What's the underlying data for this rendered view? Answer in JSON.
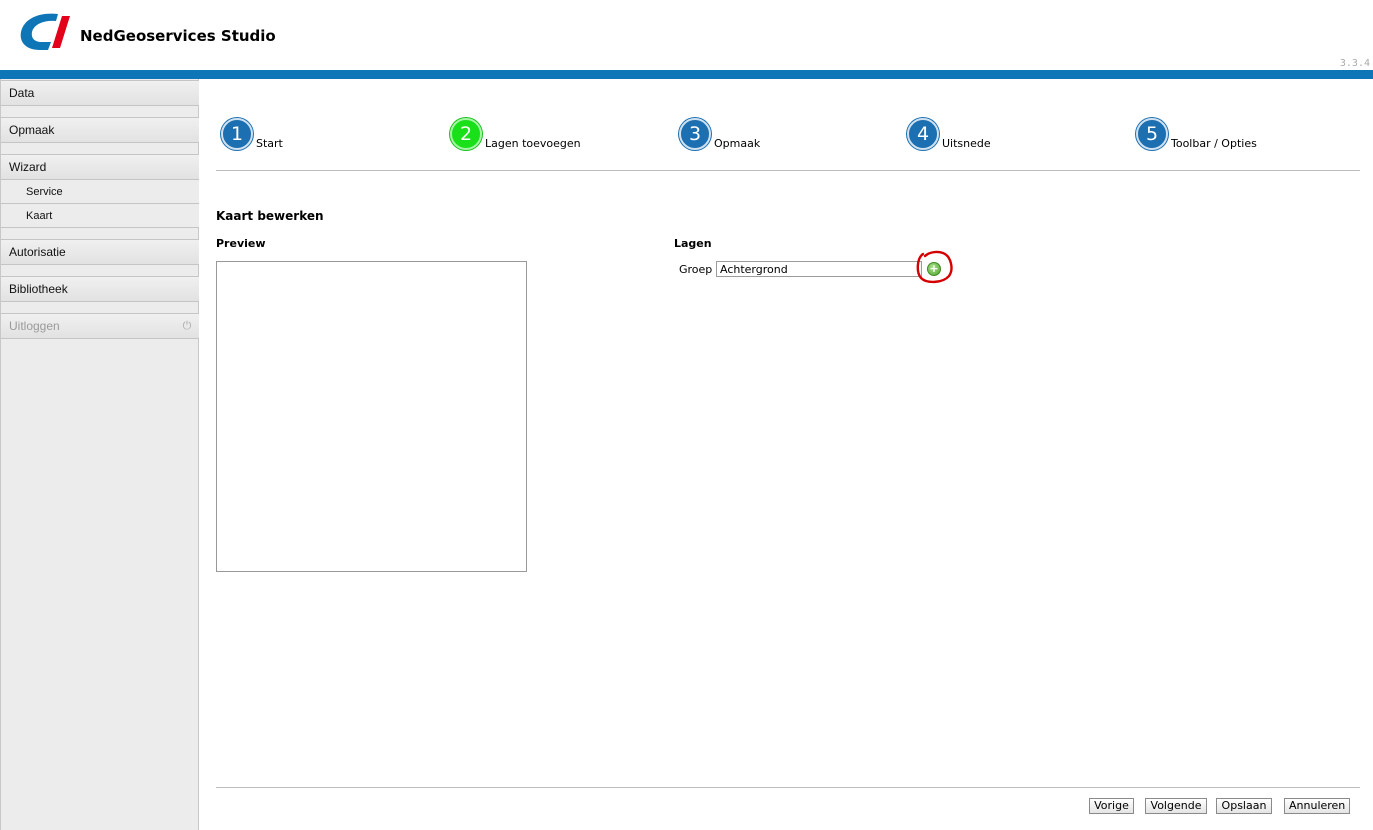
{
  "header": {
    "app_title": "NedGeoservices Studio",
    "version": "3.3.4",
    "logo_icon": "nedgeo-logo-icon",
    "brand_colors": {
      "logo_blue": "#0e76b7",
      "logo_red": "#e2001a",
      "topbar": "#0e76b7"
    }
  },
  "sidebar": {
    "items": [
      {
        "label": "Data"
      },
      {
        "label": "Opmaak"
      },
      {
        "label": "Wizard",
        "children": [
          {
            "label": "Service"
          },
          {
            "label": "Kaart"
          }
        ]
      },
      {
        "label": "Autorisatie"
      },
      {
        "label": "Bibliotheek"
      },
      {
        "label": "Uitloggen",
        "icon": "power-icon",
        "disabled": true
      }
    ]
  },
  "wizard": {
    "steps": [
      {
        "number": "1",
        "label": "Start"
      },
      {
        "number": "2",
        "label": "Lagen toevoegen",
        "active": true
      },
      {
        "number": "3",
        "label": "Opmaak"
      },
      {
        "number": "4",
        "label": "Uitsnede"
      },
      {
        "number": "5",
        "label": "Toolbar / Opties"
      }
    ],
    "colors": {
      "step": "#1c6fb0",
      "active_step": "#19e019"
    }
  },
  "main": {
    "title": "Kaart bewerken",
    "preview_label": "Preview",
    "lagen_label": "Lagen",
    "groep_label": "Groep",
    "groep_value": "Achtergrond",
    "add_icon": "plus-circle-icon",
    "annotation_color": "#d40000"
  },
  "footer": {
    "buttons": [
      {
        "label": "Vorige"
      },
      {
        "label": "Volgende"
      },
      {
        "label": "Opslaan"
      },
      {
        "label": "Annuleren"
      }
    ]
  }
}
